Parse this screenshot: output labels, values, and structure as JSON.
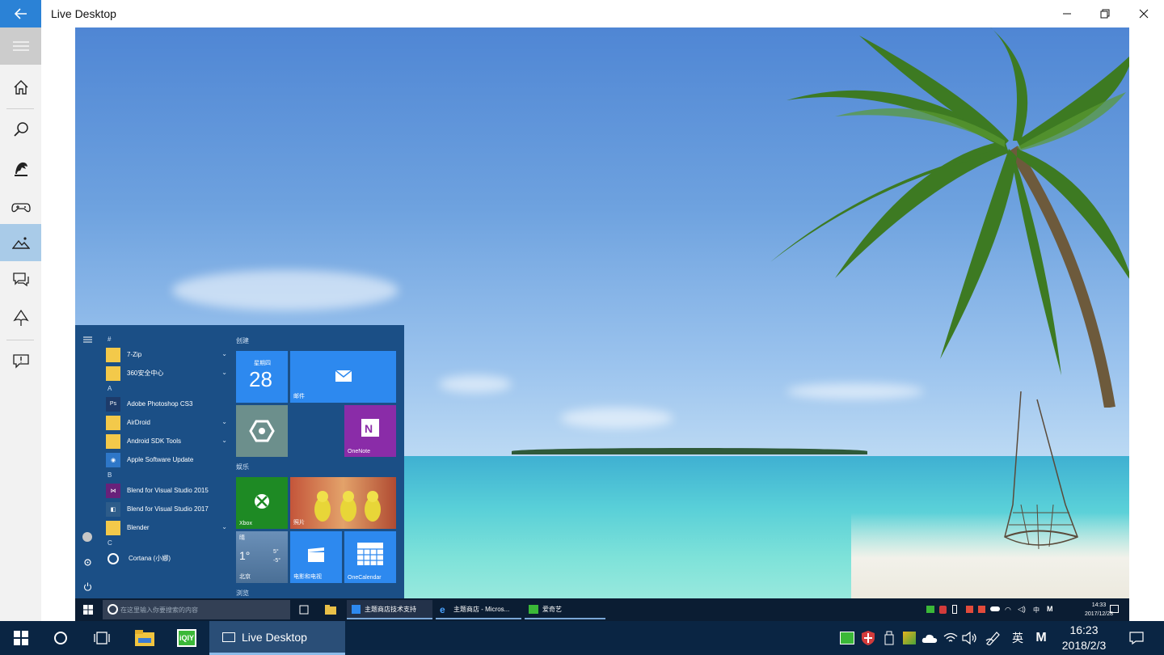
{
  "window": {
    "title": "Live Desktop",
    "back_icon": "back-arrow-icon",
    "minimize_icon": "minimize-icon",
    "restore_icon": "restore-icon",
    "close_icon": "close-icon"
  },
  "sidebar": {
    "items": [
      {
        "name": "hamburger-menu",
        "icon": "hamburger-icon"
      },
      {
        "name": "home",
        "icon": "home-icon"
      },
      {
        "name": "search",
        "icon": "search-icon"
      },
      {
        "name": "anime",
        "icon": "anime-character-icon"
      },
      {
        "name": "games",
        "icon": "game-controller-icon"
      },
      {
        "name": "landscape",
        "icon": "landscape-icon",
        "active": true
      },
      {
        "name": "comments",
        "icon": "chat-icon"
      },
      {
        "name": "plugins",
        "icon": "tree-icon"
      },
      {
        "name": "feedback",
        "icon": "feedback-icon"
      }
    ]
  },
  "preview": {
    "start_menu": {
      "groups": {
        "create": "创建",
        "play": "娱乐",
        "browse": "浏览"
      },
      "letters": {
        "hash": "#",
        "a": "A",
        "b": "B",
        "c": "C"
      },
      "apps": {
        "zip": "7-Zip",
        "s360": "360安全中心",
        "photoshop": "Adobe Photoshop CS3",
        "airdroid": "AirDroid",
        "android_sdk": "Android SDK Tools",
        "apple_update": "Apple Software Update",
        "blend2015": "Blend for Visual Studio 2015",
        "blend2017": "Blend for Visual Studio 2017",
        "blender": "Blender",
        "cortana": "Cortana (小娜)"
      },
      "tiles": {
        "calendar_day": "星期四",
        "calendar_date": "28",
        "mail": "邮件",
        "onenote": "OneNote",
        "xbox": "Xbox",
        "photos": "照片",
        "weather_temp": "1°",
        "weather_city": "北京",
        "weather_hi": "5°",
        "weather_lo": "-5°",
        "weather_cond": "晴",
        "movies": "电影和电视",
        "onecalendar": "OneCalendar"
      }
    },
    "inner_taskbar": {
      "search_placeholder": "在这里输入你要搜索的内容",
      "apps": [
        "主题商店技术支持",
        "主题商店 - Micros...",
        "爱奇艺"
      ],
      "time": "14:33",
      "date": "2017/12/28",
      "ime": "中",
      "ime_mode": "M"
    }
  },
  "taskbar": {
    "live_desktop_label": "Live Desktop",
    "ime": "英",
    "ime_mode": "M",
    "time": "16:23",
    "date": "2018/2/3"
  }
}
